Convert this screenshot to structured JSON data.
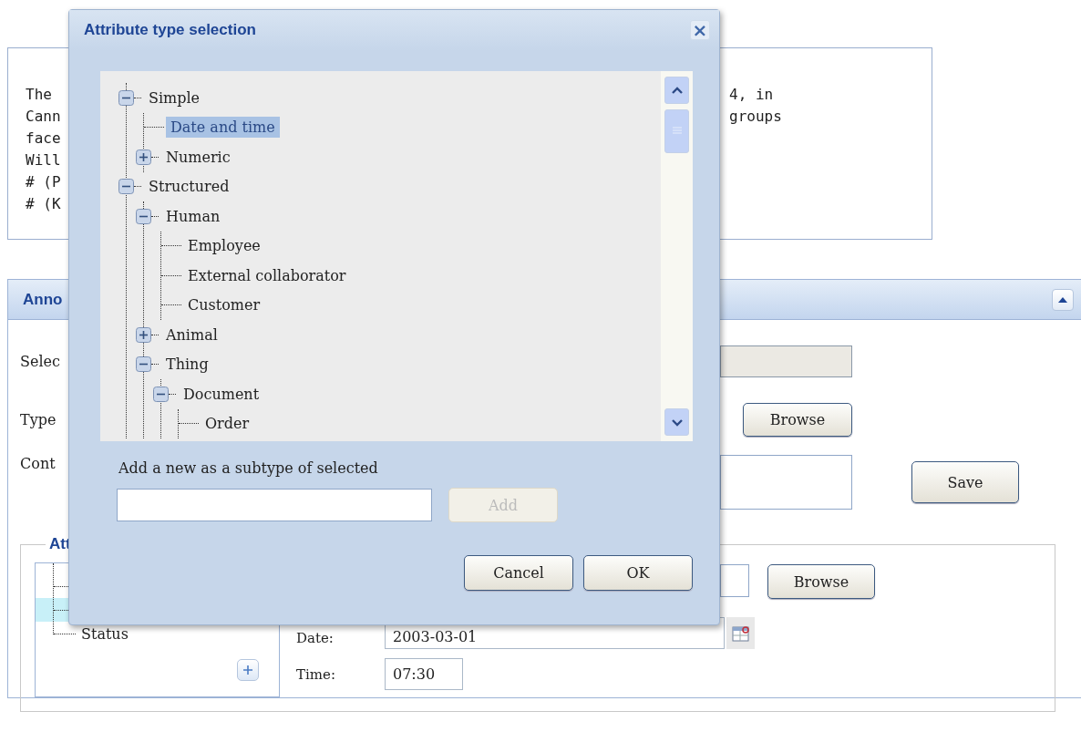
{
  "background": {
    "notes_box": {
      "left_fragments": [
        "The",
        "Cann",
        "face",
        "Will",
        "# (P",
        "# (K"
      ],
      "right_fragments": [
        "4, in",
        "groups"
      ]
    },
    "annotation_panel": {
      "title": "Anno",
      "rows": [
        {
          "kind": "field",
          "label": "Selec",
          "disabled": true
        },
        {
          "kind": "browse",
          "label": "Type",
          "button": "Browse"
        },
        {
          "kind": "textarea",
          "label": "Cont"
        }
      ],
      "save_button": "Save",
      "attributes": {
        "legend": "Att",
        "items": [
          {
            "selected": false
          },
          {
            "selected": true
          },
          {
            "label": "Status",
            "selected": false
          }
        ],
        "browse_button": "Browse",
        "date_label": "Date:",
        "date_value": "2003-03-01",
        "time_label": "Time:",
        "time_value": "07:30"
      }
    }
  },
  "dialog": {
    "title": "Attribute type selection",
    "close": "×",
    "tree": [
      {
        "label": "Simple",
        "expanded": true,
        "selected": false,
        "children": [
          {
            "label": "Date and time",
            "selected": true
          },
          {
            "label": "Numeric",
            "expanded": false,
            "selected": false
          }
        ]
      },
      {
        "label": "Structured",
        "expanded": true,
        "selected": false,
        "children": [
          {
            "label": "Human",
            "expanded": true,
            "selected": false,
            "children": [
              {
                "label": "Employee",
                "selected": false
              },
              {
                "label": "External collaborator",
                "selected": false
              },
              {
                "label": "Customer",
                "selected": false
              }
            ]
          },
          {
            "label": "Animal",
            "expanded": false,
            "selected": false
          },
          {
            "label": "Thing",
            "expanded": true,
            "selected": false,
            "children": [
              {
                "label": "Document",
                "expanded": true,
                "selected": false,
                "children": [
                  {
                    "label": "Order",
                    "selected": false
                  }
                ]
              }
            ]
          }
        ]
      }
    ],
    "add_label": "Add a new as a subtype of selected",
    "add_button": {
      "label": "Add",
      "disabled": true
    },
    "cancel_button": "Cancel",
    "ok_button": "OK"
  }
}
